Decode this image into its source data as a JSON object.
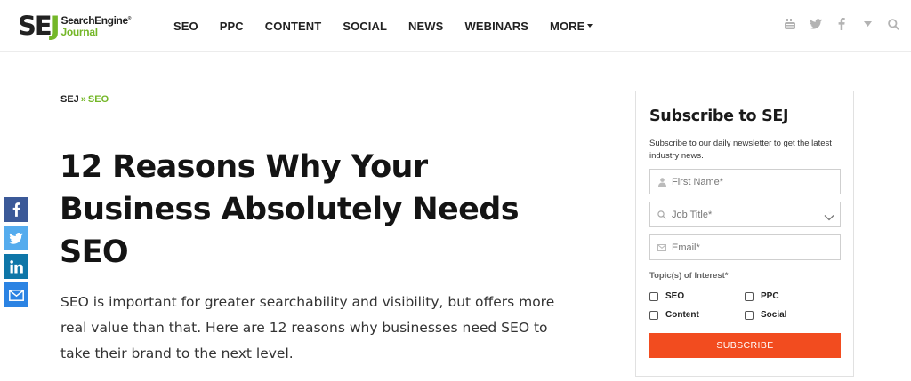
{
  "brand": {
    "sej_s": "S",
    "sej_e": "E",
    "sej_j": "J",
    "word_line1": "SearchEngine",
    "word_line2": "Journal",
    "registered_mark": "®",
    "accent_color": "#74b728"
  },
  "nav": {
    "items": [
      {
        "label": "SEO"
      },
      {
        "label": "PPC"
      },
      {
        "label": "CONTENT"
      },
      {
        "label": "SOCIAL"
      },
      {
        "label": "NEWS"
      },
      {
        "label": "WEBINARS"
      },
      {
        "label": "MORE"
      }
    ],
    "icons": [
      "youtube-icon",
      "twitter-icon",
      "facebook-icon",
      "dropdown-caret-icon",
      "search-icon"
    ]
  },
  "share": {
    "buttons": [
      "facebook-icon",
      "twitter-icon",
      "linkedin-icon",
      "email-icon"
    ],
    "colors": {
      "facebook": "#3b5998",
      "twitter": "#55acee",
      "linkedin": "#0e76a8",
      "email": "#2b83e3"
    }
  },
  "breadcrumb": {
    "home": "SEJ",
    "separator": "»",
    "current": "SEO"
  },
  "article": {
    "title": "12 Reasons Why Your Business Absolutely Needs SEO",
    "lede": "SEO is important for greater searchability and visibility, but offers more real value than that. Here are 12 reasons why businesses need SEO to take their brand to the next level."
  },
  "subscribe": {
    "title": "Subscribe to SEJ",
    "description": "Subscribe to our daily newsletter to get the latest industry news.",
    "first_name_placeholder": "First Name*",
    "job_title_placeholder": "Job Title*",
    "email_placeholder": "Email*",
    "topics_label": "Topic(s) of Interest*",
    "topics": [
      {
        "label": "SEO",
        "checked": false
      },
      {
        "label": "PPC",
        "checked": false
      },
      {
        "label": "Content",
        "checked": false
      },
      {
        "label": "Social",
        "checked": false
      }
    ],
    "button_label": "SUBSCRIBE",
    "button_color": "#f24c1f"
  }
}
